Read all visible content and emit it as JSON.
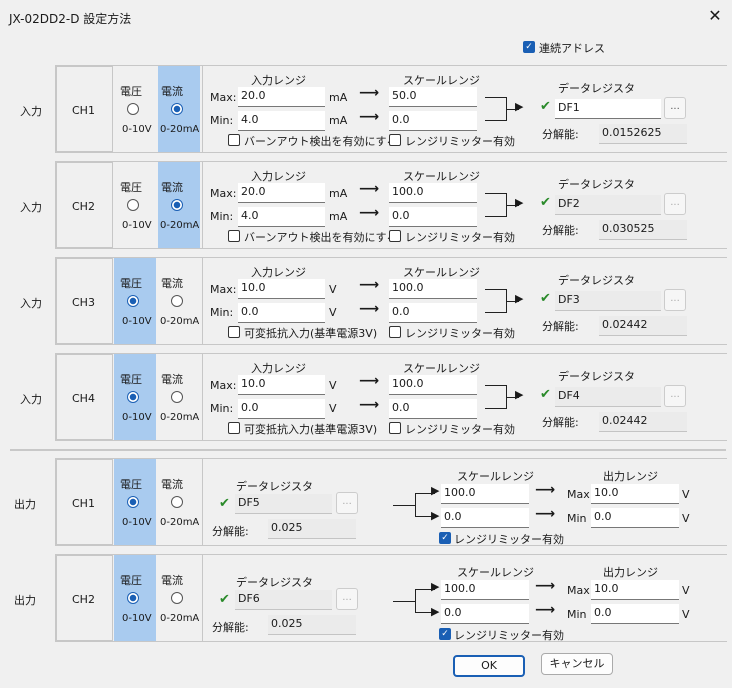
{
  "window": {
    "title": "JX-02DD2-D 設定方法"
  },
  "continuous_address": {
    "label": "連続アドレス",
    "checked": true
  },
  "common": {
    "voltage": "電圧",
    "current": "電流",
    "v_range": "0-10V",
    "ma_range": "0-20mA",
    "input_range": "入力レンジ",
    "scale_range": "スケールレンジ",
    "output_range": "出力レンジ",
    "data_register": "データレジスタ",
    "resolution": "分解能:",
    "max": "Max:",
    "min": "Min:",
    "max_out": "Max",
    "min_out": "Min",
    "burnout": "バーンアウト検出を有効にする",
    "limiter": "レンジリミッター有効",
    "variable_resistor": "可変抵抗入力(基準電源3V)",
    "browse": "..."
  },
  "inputs": [
    {
      "side": "入力",
      "ch": "CH1",
      "mode": "current",
      "max": "20.0",
      "min": "4.0",
      "unit": "mA",
      "scale_max": "50.0",
      "scale_min": "0.0",
      "register": "DF1",
      "resolution": "0.0152625",
      "option": "burnout",
      "option_checked": false,
      "limiter_checked": false
    },
    {
      "side": "入力",
      "ch": "CH2",
      "mode": "current",
      "max": "20.0",
      "min": "4.0",
      "unit": "mA",
      "scale_max": "100.0",
      "scale_min": "0.0",
      "register": "DF2",
      "resolution": "0.030525",
      "option": "burnout",
      "option_checked": false,
      "limiter_checked": false
    },
    {
      "side": "入力",
      "ch": "CH3",
      "mode": "voltage",
      "max": "10.0",
      "min": "0.0",
      "unit": "V",
      "scale_max": "100.0",
      "scale_min": "0.0",
      "register": "DF3",
      "resolution": "0.02442",
      "option": "variable_resistor",
      "option_checked": false,
      "limiter_checked": false
    },
    {
      "side": "入力",
      "ch": "CH4",
      "mode": "voltage",
      "max": "10.0",
      "min": "0.0",
      "unit": "V",
      "scale_max": "100.0",
      "scale_min": "0.0",
      "register": "DF4",
      "resolution": "0.02442",
      "option": "variable_resistor",
      "option_checked": false,
      "limiter_checked": false
    }
  ],
  "outputs": [
    {
      "side": "出力",
      "ch": "CH1",
      "mode": "voltage",
      "register": "DF5",
      "resolution": "0.025",
      "scale_max": "100.0",
      "scale_min": "0.0",
      "out_max": "10.0",
      "out_min": "0.0",
      "unit": "V",
      "limiter_checked": true
    },
    {
      "side": "出力",
      "ch": "CH2",
      "mode": "voltage",
      "register": "DF6",
      "resolution": "0.025",
      "scale_max": "100.0",
      "scale_min": "0.0",
      "out_max": "10.0",
      "out_min": "0.0",
      "unit": "V",
      "limiter_checked": true
    }
  ],
  "buttons": {
    "ok": "OK",
    "cancel": "キャンセル"
  },
  "colors": {
    "accent": "#1a5fb4",
    "selected_bg": "#a9cbef",
    "valid_check": "#2a8a2a"
  }
}
